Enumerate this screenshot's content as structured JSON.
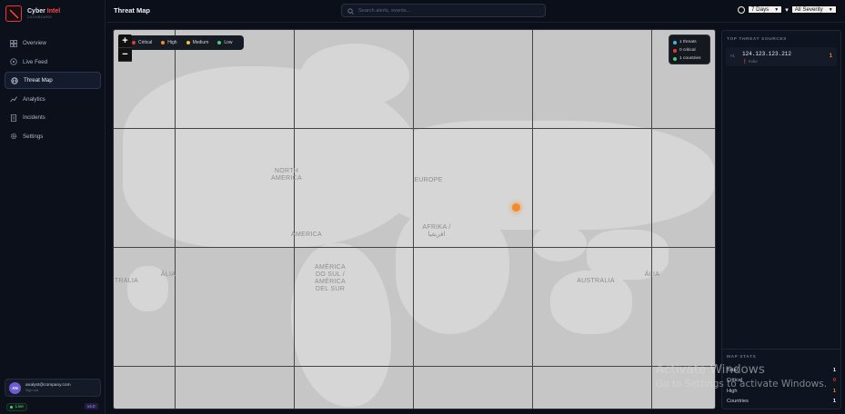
{
  "brand": {
    "name_main": "Cyber ",
    "name_accent": "Intel",
    "subtitle": "DASHBOARD",
    "accent_color": "#ff4b4b"
  },
  "sidebar": {
    "items": [
      {
        "label": "Overview",
        "icon": "grid-icon",
        "active": false
      },
      {
        "label": "Live Feed",
        "icon": "radar-icon",
        "active": false
      },
      {
        "label": "Threat Map",
        "icon": "globe-icon",
        "active": true
      },
      {
        "label": "Analytics",
        "icon": "chart-icon",
        "active": false
      },
      {
        "label": "Incidents",
        "icon": "document-icon",
        "active": false
      },
      {
        "label": "Settings",
        "icon": "gear-icon",
        "active": false
      }
    ],
    "user": {
      "initials": "AN",
      "email": "analyst@company.com",
      "role": "Sign out"
    },
    "status": "Live",
    "version": "v4.0"
  },
  "header": {
    "title": "Threat Map",
    "search_placeholder": "Search alerts, events...",
    "time_filter": "7 Days",
    "severity_filter": "All Severity"
  },
  "map": {
    "legend": [
      {
        "label": "Critical",
        "color": "#e23a3a"
      },
      {
        "label": "High",
        "color": "#f48a2a"
      },
      {
        "label": "Medium",
        "color": "#f2c12e"
      },
      {
        "label": "Low",
        "color": "#3fcf7b"
      }
    ],
    "zoom_in": "+",
    "zoom_out": "−",
    "overlay_stats": [
      {
        "text": "1 threats",
        "color": "#3fb8e0"
      },
      {
        "text": "0 critical",
        "color": "#e23a3a"
      },
      {
        "text": "1 countries",
        "color": "#3fcf7b"
      }
    ],
    "labels": {
      "north_america": "NORTH\nAMERICA",
      "europe": "EUROPE",
      "africa": "AFRIKA /\nافريقيا",
      "america": "AMERICA",
      "south_america": "AMÉRICA\nDO SUL /\nAMÉRICA\nDEL SUR",
      "australia": "AUSTRALIA",
      "australia_left": "TRALIA",
      "oceania_left": "ÁLIA",
      "oceania_right": "ÁLIA"
    },
    "threat_color": "#f48a2a"
  },
  "right_panel": {
    "top_sources_title": "TOP THREAT SOURCES",
    "sources": [
      {
        "rank": "#1",
        "ip": "124.123.123.212",
        "country": "India",
        "count": "1"
      }
    ],
    "map_stats_title": "MAP STATS",
    "map_stats": [
      {
        "label": "Total",
        "value": "1",
        "color": "#ffffff"
      },
      {
        "label": "Critical",
        "value": "0",
        "color": "#e23a3a"
      },
      {
        "label": "High",
        "value": "1",
        "color": "#f48a2a"
      },
      {
        "label": "Countries",
        "value": "1",
        "color": "#ffffff"
      }
    ]
  },
  "watermark": {
    "line1": "Activate Windows",
    "line2": "Go to Settings to activate Windows."
  }
}
